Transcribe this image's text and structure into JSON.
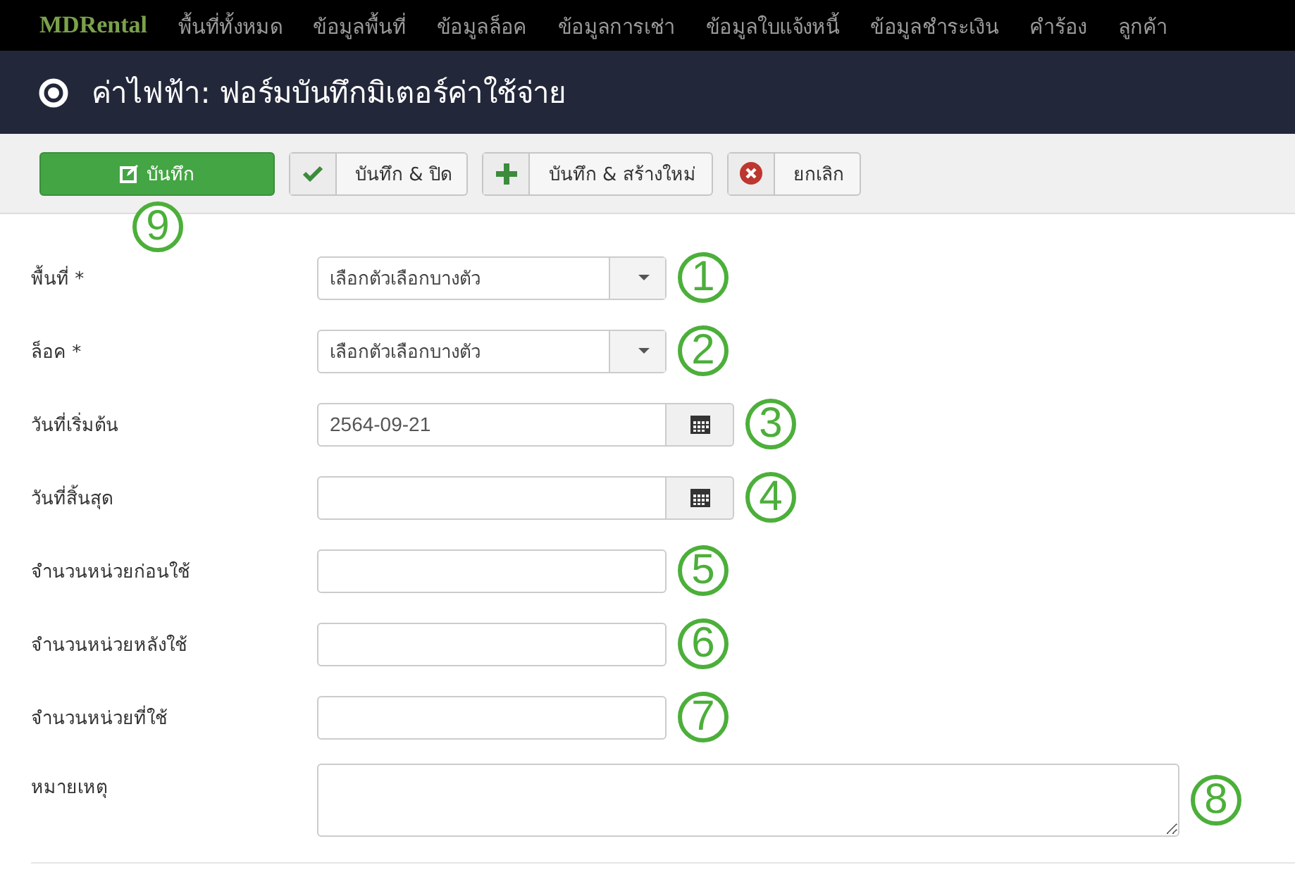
{
  "navbar": {
    "brand": "MDRental",
    "items": [
      "พื้นที่ทั้งหมด",
      "ข้อมูลพื้นที่",
      "ข้อมูลล็อค",
      "ข้อมูลการเช่า",
      "ข้อมูลใบแจ้งหนี้",
      "ข้อมูลชำระเงิน",
      "คำร้อง",
      "ลูกค้า"
    ]
  },
  "header": {
    "title": "ค่าไฟฟ้า: ฟอร์มบันทึกมิเตอร์ค่าใช้จ่าย"
  },
  "toolbar": [
    {
      "label": "บันทึก",
      "kind": "save",
      "callout": "9"
    },
    {
      "label": "บันทึก & ปิด",
      "kind": "save-close"
    },
    {
      "label": "บันทึก & สร้างใหม่",
      "kind": "save-new"
    },
    {
      "label": "ยกเลิก",
      "kind": "cancel"
    }
  ],
  "fields": [
    {
      "label": "พื้นที่ *",
      "kind": "select",
      "placeholder": "เลือกตัวเลือกบางตัว",
      "callout": "1"
    },
    {
      "label": "ล็อค *",
      "kind": "select",
      "placeholder": "เลือกตัวเลือกบางตัว",
      "callout": "2"
    },
    {
      "label": "วันที่เริ่มต้น",
      "kind": "date",
      "value": "2564-09-21",
      "callout": "3"
    },
    {
      "label": "วันที่สิ้นสุด",
      "kind": "date",
      "callout": "4"
    },
    {
      "label": "จำนวนหน่วยก่อนใช้",
      "kind": "text",
      "callout": "5"
    },
    {
      "label": "จำนวนหน่วยหลังใช้",
      "kind": "text",
      "callout": "6"
    },
    {
      "label": "จำนวนหน่วยที่ใช้",
      "kind": "text",
      "callout": "7"
    },
    {
      "label": "หมายเหตุ",
      "kind": "textarea",
      "callout": "8"
    }
  ]
}
